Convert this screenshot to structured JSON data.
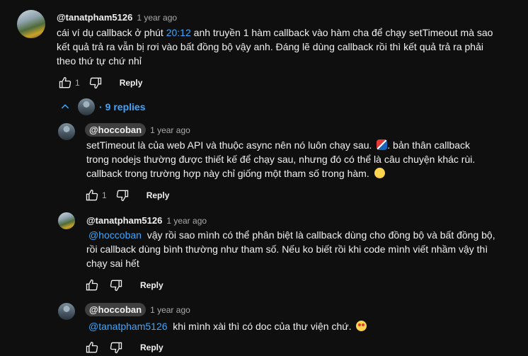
{
  "comment": {
    "author": "@tanatpham5126",
    "time": "1 year ago",
    "text_pre": "cái ví dụ callback ở phút ",
    "timestamp_link": "20:12",
    "text_line1_post": " anh truyền 1 hàm callback vào hàm cha để chạy setTimeout mà sao",
    "text_line2": "kết quả trả ra vẫn bị rơi vào bất đồng bộ vậy anh. Đáng lẽ dùng callback rồi thì kết quả trả ra phải",
    "text_line3": "theo thứ tự chứ nhỉ",
    "like_count": "1",
    "reply_label": "Reply"
  },
  "replies_toggle": {
    "label": "9 replies",
    "icon": "chevron-up-icon"
  },
  "replies": [
    {
      "author": "@hoccoban",
      "time": "1 year ago",
      "line1": "setTimeout là của web API và thuộc async nên nó luôn chạy sau.",
      "line1_post": ". bản thân callback",
      "line2": "trong nodejs thường được thiết kế để chạy sau, nhưng đó có thể là câu chuyện khác rùi.",
      "line3": "callback trong trường hợp này chỉ giống một tham số trong hàm.",
      "like_count": "1",
      "reply_label": "Reply"
    },
    {
      "author": "@tanatpham5126",
      "time": "1 year ago",
      "mention": "@hoccoban",
      "line1": "  vậy rồi sao mình có thể phân biệt là callback dùng cho đồng bộ và bất đồng bộ,",
      "line2": "rồi  callback dùng bình thường như tham số. Nếu ko biết rồi khi code mình viết nhầm vậy thì",
      "line3": "chạy sai hết",
      "reply_label": "Reply"
    },
    {
      "author": "@hoccoban",
      "time": "1 year ago",
      "mention": "@tanatpham5126",
      "line1": "  khi mình xài thì có doc của thư viện chứ.",
      "reply_label": "Reply"
    }
  ],
  "colors": {
    "background": "#0f0f0f",
    "text": "#f1f1f1",
    "secondary": "#aaaaaa",
    "link": "#3ea6ff",
    "chip": "#3f3f3f"
  }
}
